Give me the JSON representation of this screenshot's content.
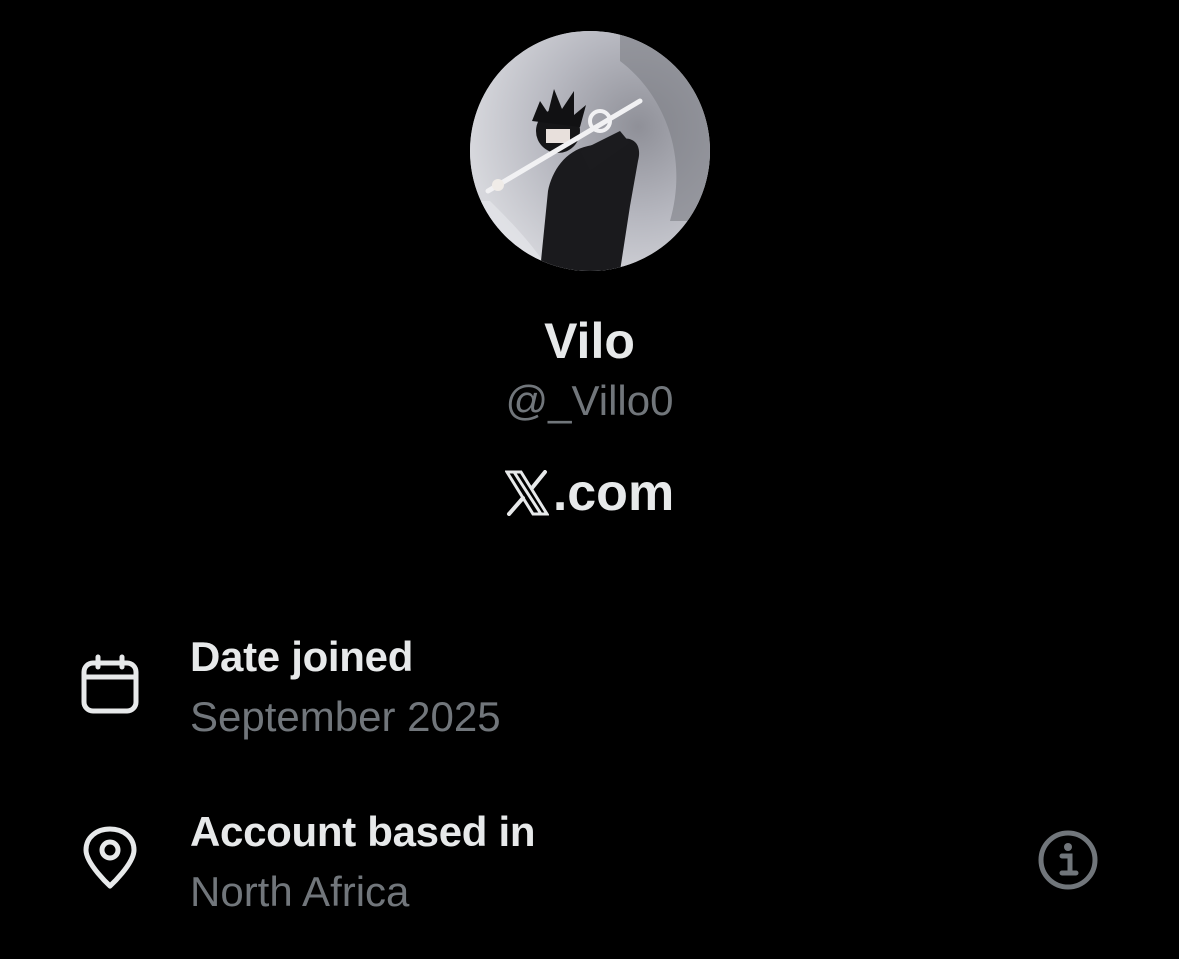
{
  "profile": {
    "display_name": "Vilo",
    "handle": "@_Villo0"
  },
  "brand": {
    "domain_text": ".com"
  },
  "details": [
    {
      "icon": "calendar-icon",
      "title": "Date joined",
      "value": "September 2025"
    },
    {
      "icon": "location-pin-icon",
      "title": "Account based in",
      "value": "North Africa",
      "action_icon": "info-icon"
    }
  ],
  "colors": {
    "background": "#000000",
    "primary_text": "#e7e9ea",
    "secondary_text": "#71767b"
  }
}
